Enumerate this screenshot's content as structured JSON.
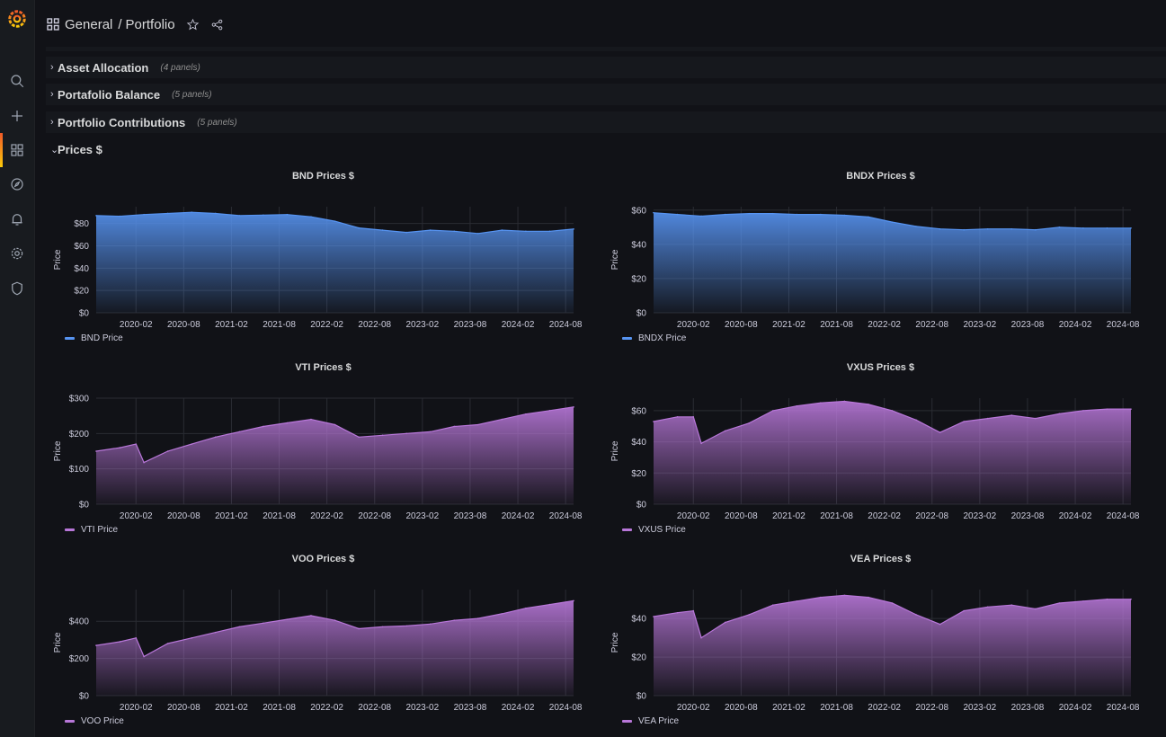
{
  "header": {
    "folder": "General",
    "separator": "/",
    "dashboard": "Portfolio"
  },
  "nav": {
    "items": [
      "search-icon",
      "plus-icon",
      "dashboards-icon",
      "explore-icon",
      "alerting-icon",
      "configuration-icon",
      "shield-icon"
    ],
    "active": "dashboards-icon"
  },
  "rows": [
    {
      "title": "Asset Allocation",
      "count": "(4 panels)",
      "collapsed": true
    },
    {
      "title": "Portafolio Balance",
      "count": "(5 panels)",
      "collapsed": true
    },
    {
      "title": "Portfolio Contributions",
      "count": "(5 panels)",
      "collapsed": true
    },
    {
      "title": "Prices $",
      "count": "",
      "collapsed": false
    }
  ],
  "colors": {
    "blue": "#5794f2",
    "purple": "#b877d9",
    "background": "#111217",
    "accent": "#f05a28"
  },
  "x_axis_ticks": [
    "2020-02",
    "2020-08",
    "2021-02",
    "2021-08",
    "2022-02",
    "2022-08",
    "2023-02",
    "2023-08",
    "2024-02",
    "2024-08"
  ],
  "chart_data": [
    {
      "type": "area",
      "title": "BND Prices $",
      "ylabel": "Price",
      "color": "blue",
      "ylim": [
        0,
        95
      ],
      "yticks": [
        0,
        20,
        40,
        60,
        80
      ],
      "ytick_labels": [
        "$0",
        "$20",
        "$40",
        "$60",
        "$80"
      ],
      "series": [
        {
          "name": "BND Price",
          "x": [
            "2019-09",
            "2019-12",
            "2020-03",
            "2020-06",
            "2020-09",
            "2020-12",
            "2021-03",
            "2021-06",
            "2021-09",
            "2021-12",
            "2022-03",
            "2022-06",
            "2022-09",
            "2022-12",
            "2023-03",
            "2023-06",
            "2023-09",
            "2023-12",
            "2024-03",
            "2024-06",
            "2024-09"
          ],
          "values": [
            87,
            86.5,
            88,
            89,
            90,
            89,
            87,
            87.5,
            88,
            86,
            82,
            76,
            74,
            72,
            74,
            73,
            71,
            74,
            73,
            73,
            75
          ]
        }
      ]
    },
    {
      "type": "area",
      "title": "BNDX Prices $",
      "ylabel": "Price",
      "color": "blue",
      "ylim": [
        0,
        62
      ],
      "yticks": [
        0,
        20,
        40,
        60
      ],
      "ytick_labels": [
        "$0",
        "$20",
        "$40",
        "$60"
      ],
      "series": [
        {
          "name": "BNDX Price",
          "x": [
            "2019-09",
            "2019-12",
            "2020-03",
            "2020-06",
            "2020-09",
            "2020-12",
            "2021-03",
            "2021-06",
            "2021-09",
            "2021-12",
            "2022-03",
            "2022-06",
            "2022-09",
            "2022-12",
            "2023-03",
            "2023-06",
            "2023-09",
            "2023-12",
            "2024-03",
            "2024-06",
            "2024-09"
          ],
          "values": [
            58.5,
            57.5,
            56.5,
            57.5,
            58,
            58,
            57.5,
            57.5,
            57,
            56,
            53,
            50.5,
            49,
            48.5,
            49,
            49,
            48.5,
            50,
            49.5,
            49.5,
            49.5
          ]
        }
      ]
    },
    {
      "type": "area",
      "title": "VTI Prices $",
      "ylabel": "Price",
      "color": "purple",
      "ylim": [
        0,
        300
      ],
      "yticks": [
        0,
        100,
        200,
        300
      ],
      "ytick_labels": [
        "$0",
        "$100",
        "$200",
        "$300"
      ],
      "series": [
        {
          "name": "VTI Price",
          "x": [
            "2019-09",
            "2019-12",
            "2020-02",
            "2020-03",
            "2020-06",
            "2020-09",
            "2020-12",
            "2021-03",
            "2021-06",
            "2021-09",
            "2021-12",
            "2022-03",
            "2022-06",
            "2022-09",
            "2022-12",
            "2023-03",
            "2023-06",
            "2023-09",
            "2023-12",
            "2024-03",
            "2024-06",
            "2024-09"
          ],
          "values": [
            150,
            160,
            170,
            118,
            150,
            170,
            190,
            205,
            220,
            230,
            240,
            225,
            190,
            195,
            200,
            205,
            220,
            225,
            240,
            255,
            265,
            275
          ]
        }
      ]
    },
    {
      "type": "area",
      "title": "VXUS Prices $",
      "ylabel": "Price",
      "color": "purple",
      "ylim": [
        0,
        68
      ],
      "yticks": [
        0,
        20,
        40,
        60
      ],
      "ytick_labels": [
        "$0",
        "$20",
        "$40",
        "$60"
      ],
      "series": [
        {
          "name": "VXUS Price",
          "x": [
            "2019-09",
            "2019-12",
            "2020-02",
            "2020-03",
            "2020-06",
            "2020-09",
            "2020-12",
            "2021-03",
            "2021-06",
            "2021-09",
            "2021-12",
            "2022-03",
            "2022-06",
            "2022-09",
            "2022-12",
            "2023-03",
            "2023-06",
            "2023-09",
            "2023-12",
            "2024-03",
            "2024-06",
            "2024-09"
          ],
          "values": [
            53,
            56,
            56,
            39,
            47,
            52,
            60,
            63,
            65,
            66,
            64,
            60,
            54,
            46,
            53,
            55,
            57,
            55,
            58,
            60,
            61,
            61
          ]
        }
      ]
    },
    {
      "type": "area",
      "title": "VOO Prices $",
      "ylabel": "Price",
      "color": "purple",
      "ylim": [
        0,
        570
      ],
      "yticks": [
        0,
        200,
        400
      ],
      "ytick_labels": [
        "$0",
        "$200",
        "$400"
      ],
      "series": [
        {
          "name": "VOO Price",
          "x": [
            "2019-09",
            "2019-12",
            "2020-02",
            "2020-03",
            "2020-06",
            "2020-09",
            "2020-12",
            "2021-03",
            "2021-06",
            "2021-09",
            "2021-12",
            "2022-03",
            "2022-06",
            "2022-09",
            "2022-12",
            "2023-03",
            "2023-06",
            "2023-09",
            "2023-12",
            "2024-03",
            "2024-06",
            "2024-09"
          ],
          "values": [
            270,
            290,
            310,
            210,
            280,
            310,
            340,
            370,
            390,
            410,
            430,
            405,
            360,
            370,
            375,
            385,
            405,
            415,
            440,
            470,
            490,
            510
          ]
        }
      ]
    },
    {
      "type": "area",
      "title": "VEA Prices $",
      "ylabel": "Price",
      "color": "purple",
      "ylim": [
        0,
        55
      ],
      "yticks": [
        0,
        20,
        40
      ],
      "ytick_labels": [
        "$0",
        "$20",
        "$40"
      ],
      "series": [
        {
          "name": "VEA Price",
          "x": [
            "2019-09",
            "2019-12",
            "2020-02",
            "2020-03",
            "2020-06",
            "2020-09",
            "2020-12",
            "2021-03",
            "2021-06",
            "2021-09",
            "2021-12",
            "2022-03",
            "2022-06",
            "2022-09",
            "2022-12",
            "2023-03",
            "2023-06",
            "2023-09",
            "2023-12",
            "2024-03",
            "2024-06",
            "2024-09"
          ],
          "values": [
            41,
            43,
            44,
            30,
            38,
            42,
            47,
            49,
            51,
            52,
            51,
            48,
            42,
            37,
            44,
            46,
            47,
            45,
            48,
            49,
            50,
            50
          ]
        }
      ]
    }
  ]
}
